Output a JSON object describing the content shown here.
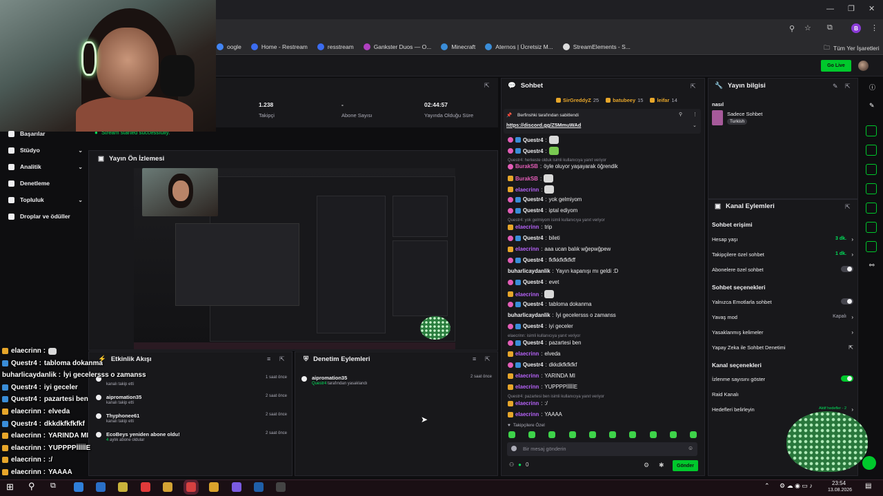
{
  "bookmarks": [
    {
      "label": "oogle",
      "color": "#4285f4"
    },
    {
      "label": "Home - Restream",
      "color": "#3b6cf0"
    },
    {
      "label": "resstream",
      "color": "#3b6cf0"
    },
    {
      "label": "Gankster Duos — O...",
      "color": "#b040c0"
    },
    {
      "label": "Minecraft",
      "color": "#3a8dd8"
    },
    {
      "label": "Aternos | Ücretsiz M...",
      "color": "#3a8dd8"
    },
    {
      "label": "StreamElements - S...",
      "color": "#dddddd"
    }
  ],
  "bookmarks_all": "Tüm Yer İşaretleri",
  "app_bar": {
    "go_live": "Go Live"
  },
  "nav": [
    {
      "label": "Başarılar",
      "chev": ""
    },
    {
      "label": "Stüdyo",
      "chev": "⌄"
    },
    {
      "label": "Analitik",
      "chev": "⌄"
    },
    {
      "label": "Denetleme",
      "chev": ""
    },
    {
      "label": "Topluluk",
      "chev": "⌄"
    },
    {
      "label": "Droplar ve ödüller",
      "chev": ""
    }
  ],
  "stats": [
    {
      "value": "1.238",
      "label": "Takipçi"
    },
    {
      "value": "-",
      "label": "Abone Sayısı"
    },
    {
      "value": "02:44:57",
      "label": "Yayında Olduğu Süre"
    }
  ],
  "stream_started": "Stream started successfully.",
  "preview": {
    "title": "Yayın Ön İzlemesi"
  },
  "activity": {
    "title": "Etkinlik Akışı",
    "items": [
      {
        "name": "",
        "sub": "kanalı takip etti",
        "time": "1 saat önce"
      },
      {
        "name": "aipromation35",
        "sub": "kanalı takip etti",
        "time": "2 saat önce"
      },
      {
        "name": "Thyphonee61",
        "sub": "kanalı takip etti",
        "time": "2 saat önce"
      },
      {
        "name": "EcoBeys yeniden abone oldu!",
        "sub_hl": "4",
        "sub": " aylık abone oldular",
        "time": "2 saat önce"
      }
    ]
  },
  "moderation": {
    "title": "Denetim Eylemleri",
    "items": [
      {
        "name": "aipromation35",
        "by": "Questr4",
        "sub": " tarafından yasaklandı",
        "time": "2 saat önce"
      }
    ]
  },
  "chat": {
    "title": "Sohbet",
    "top_users": [
      {
        "name": "SirGreddyZ",
        "count": "25"
      },
      {
        "name": "batubeey",
        "count": "15"
      },
      {
        "name": "leifar",
        "count": "14"
      }
    ],
    "pinned_by": "Berfinshki tarafından sabitlendi",
    "pinned_link": "https://discord.gg/Z5MmuWAd",
    "messages": [
      {
        "badges": [
          "pink",
          "blue"
        ],
        "user": "Questr4",
        "cls": "u-q",
        "text": "",
        "emote": "gray"
      },
      {
        "badges": [
          "pink",
          "blue"
        ],
        "user": "Questr4",
        "cls": "u-q",
        "text": "",
        "emote": "green"
      },
      {
        "reply": "Questr4: herkeste olduk isimli kullanıcıya yanıt veriyor"
      },
      {
        "badges": [
          "pink"
        ],
        "user": "BurakSB",
        "cls": "u-b",
        "text": "öyle oluyor yaşayarak öğrendik"
      },
      {
        "badges": [
          "gold"
        ],
        "user": "BurakSB",
        "cls": "u-b",
        "text": "",
        "emote": "gray"
      },
      {
        "badges": [
          "gold"
        ],
        "user": "elaecrinn",
        "cls": "u-e",
        "text": "",
        "emote": "gray"
      },
      {
        "badges": [
          "pink",
          "blue"
        ],
        "user": "Questr4",
        "cls": "u-q",
        "text": "yok gelmiyom"
      },
      {
        "badges": [
          "pink",
          "blue"
        ],
        "user": "Questr4",
        "cls": "u-q",
        "text": "iptal ediyom"
      },
      {
        "reply": "Questr4: yok gelmiyom isimli kullanıcıya yanıt veriyor"
      },
      {
        "badges": [
          "gold"
        ],
        "user": "elaecrinn",
        "cls": "u-e",
        "text": "trip"
      },
      {
        "badges": [
          "pink",
          "blue"
        ],
        "user": "Questr4",
        "cls": "u-q",
        "text": "bileti"
      },
      {
        "badges": [
          "gold"
        ],
        "user": "elaecrinn",
        "cls": "u-e",
        "text": "aaa ucan balık wğepwğpew"
      },
      {
        "badges": [
          "pink",
          "blue"
        ],
        "user": "Questr4",
        "cls": "u-q",
        "text": "fkfkkfkfkfkff"
      },
      {
        "badges": [],
        "user": "buharlicaydanlik",
        "cls": "u-h",
        "text": "Yayın kapanışı mı geldi :D"
      },
      {
        "badges": [
          "pink",
          "blue"
        ],
        "user": "Questr4",
        "cls": "u-q",
        "text": "evet"
      },
      {
        "badges": [
          "gold"
        ],
        "user": "elaecrinn",
        "cls": "u-e",
        "text": "",
        "emote": "gray"
      },
      {
        "badges": [
          "pink",
          "blue"
        ],
        "user": "Questr4",
        "cls": "u-q",
        "text": "tabloma dokanma"
      },
      {
        "badges": [],
        "user": "buharlicaydanlik",
        "cls": "u-h",
        "text": "İyi gecelersss o zamanss"
      },
      {
        "badges": [
          "pink",
          "blue"
        ],
        "user": "Questr4",
        "cls": "u-q",
        "text": "iyi geceler"
      },
      {
        "reply": "elaecrinn: isimli kullanıcıya yanıt veriyor"
      },
      {
        "badges": [
          "pink",
          "blue"
        ],
        "user": "Questr4",
        "cls": "u-q",
        "text": "pazartesi ben"
      },
      {
        "badges": [
          "gold"
        ],
        "user": "elaecrinn",
        "cls": "u-e",
        "text": "elveda"
      },
      {
        "badges": [
          "pink",
          "blue"
        ],
        "user": "Questr4",
        "cls": "u-q",
        "text": "dkkdkfkfkfkf"
      },
      {
        "badges": [
          "gold"
        ],
        "user": "elaecrinn",
        "cls": "u-e",
        "text": "YARINDA MI"
      },
      {
        "badges": [
          "gold"
        ],
        "user": "elaecrinn",
        "cls": "u-e",
        "text": "YUPPPPİİİİİE"
      },
      {
        "reply": "Questr4: pazartesi ben isimli kullanıcıya yanıt veriyor"
      },
      {
        "badges": [
          "gold"
        ],
        "user": "elaecrinn",
        "cls": "u-e",
        "text": ":/"
      },
      {
        "badges": [
          "gold"
        ],
        "user": "elaecrinn",
        "cls": "u-e",
        "text": "YAAAA"
      }
    ],
    "followers_only": "Takipçilere Özel",
    "input_placeholder": "Bir mesaj gönderin",
    "points": "0",
    "send": "Gönder"
  },
  "info": {
    "title": "Yayın bilgisi",
    "stream_title": "nasıl",
    "category": "Sadece Sohbet",
    "tag": "Turkish"
  },
  "actions": {
    "title": "Kanal Eylemleri",
    "sections": [
      {
        "head": "Sohbet erişimi",
        "rows": [
          {
            "label": "Hesap yaşı",
            "value": "3 dk.",
            "kind": "val-arrow"
          },
          {
            "label": "Takipçilere özel sohbet",
            "value": "1 dk.",
            "kind": "val-arrow"
          },
          {
            "label": "Abonelere özel sohbet",
            "kind": "toggle-off"
          }
        ]
      },
      {
        "head": "Sohbet seçenekleri",
        "rows": [
          {
            "label": "Yalnızca Emotlarla sohbet",
            "kind": "toggle-off"
          },
          {
            "label": "Yavaş mod",
            "value": "Kapalı",
            "kind": "val2-arrow"
          },
          {
            "label": "Yasaklanmış kelimeler",
            "kind": "arrow"
          },
          {
            "label": "Yapay Zeka ile Sohbet Denetimi",
            "kind": "ext"
          }
        ]
      },
      {
        "head": "Kanal seçenekleri",
        "rows": [
          {
            "label": "İzlenme sayısını göster",
            "kind": "toggle-on"
          },
          {
            "label": "Raid Kanalı",
            "kind": "none"
          },
          {
            "label": "Hedefleri belirleyin",
            "value": "Aktif hedefler - 2",
            "kind": "val-arrow-small"
          }
        ]
      }
    ]
  },
  "overlay_chat": [
    {
      "user": "elaecrinn",
      "badge": "#e7a62a",
      "text": ""
    },
    {
      "user": "Questr4",
      "badge": "#3a8dd8",
      "text": "tabloma dokanma"
    },
    {
      "user": "buharlicaydanlik",
      "badge": "",
      "text": "İyi gecelersss o zamanss"
    },
    {
      "user": "Questr4",
      "badge": "#3a8dd8",
      "text": "iyi geceler"
    },
    {
      "user": "Questr4",
      "badge": "#3a8dd8",
      "text": "pazartesi ben"
    },
    {
      "user": "elaecrinn",
      "badge": "#e7a62a",
      "text": "elveda"
    },
    {
      "user": "Questr4",
      "badge": "#3a8dd8",
      "text": "dkkdkfkfkfkf"
    },
    {
      "user": "elaecrinn",
      "badge": "#e7a62a",
      "text": "YARINDA MI"
    },
    {
      "user": "elaecrinn",
      "badge": "#e7a62a",
      "text": "YUPPPPİİİİİE"
    },
    {
      "user": "elaecrinn",
      "badge": "#e7a62a",
      "text": ":/"
    },
    {
      "user": "elaecrinn",
      "badge": "#e7a62a",
      "text": "YAAAA"
    }
  ],
  "taskbar": {
    "time": "23:54",
    "date": "13.08.2026"
  },
  "colors": {
    "accent": "#00c82c",
    "bg": "#0e0e10",
    "panel": "#18181b"
  }
}
